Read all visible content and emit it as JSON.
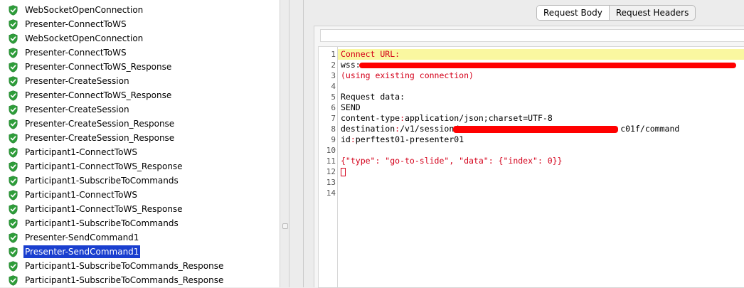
{
  "tree": {
    "items": [
      {
        "label": "WebSocketOpenConnection",
        "selected": false
      },
      {
        "label": "Presenter-ConnectToWS",
        "selected": false
      },
      {
        "label": "WebSocketOpenConnection",
        "selected": false
      },
      {
        "label": "Presenter-ConnectToWS",
        "selected": false
      },
      {
        "label": "Presenter-ConnectToWS_Response",
        "selected": false
      },
      {
        "label": "Presenter-CreateSession",
        "selected": false
      },
      {
        "label": "Presenter-ConnectToWS_Response",
        "selected": false
      },
      {
        "label": "Presenter-CreateSession",
        "selected": false
      },
      {
        "label": "Presenter-CreateSession_Response",
        "selected": false
      },
      {
        "label": "Presenter-CreateSession_Response",
        "selected": false
      },
      {
        "label": "Participant1-ConnectToWS",
        "selected": false
      },
      {
        "label": "Participant1-ConnectToWS_Response",
        "selected": false
      },
      {
        "label": "Participant1-SubscribeToCommands",
        "selected": false
      },
      {
        "label": "Participant1-ConnectToWS",
        "selected": false
      },
      {
        "label": "Participant1-ConnectToWS_Response",
        "selected": false
      },
      {
        "label": "Participant1-SubscribeToCommands",
        "selected": false
      },
      {
        "label": "Presenter-SendCommand1",
        "selected": false
      },
      {
        "label": "Presenter-SendCommand1",
        "selected": true
      },
      {
        "label": "Participant1-SubscribeToCommands_Response",
        "selected": false
      },
      {
        "label": "Participant1-SubscribeToCommands_Response",
        "selected": false
      }
    ],
    "status_icon": "green-shield-check-icon",
    "status_color": "#2e9d3a",
    "selection_color": "#1a3fcf"
  },
  "tabs": [
    {
      "label": "Request Body",
      "active": true
    },
    {
      "label": "Request Headers",
      "active": false
    }
  ],
  "editor": {
    "line_numbers": [
      "1",
      "2",
      "3",
      "4",
      "5",
      "6",
      "7",
      "8",
      "9",
      "10",
      "11",
      "12",
      "13",
      "14"
    ],
    "lines": {
      "l1": "Connect URL:",
      "l2_prefix": "wss:",
      "l3": "(using existing connection)",
      "l5": "Request data:",
      "l6": "SEND",
      "l7_key": "content-type",
      "l7_val": "application/json;charset=UTF-8",
      "l8_key": "destination",
      "l8_val": "/v1/session/",
      "l8_suffix": "c01f/command",
      "l9_key": "id",
      "l9_val": "perftest01-presenter01",
      "l11": "{\"type\": \"go-to-slide\", \"data\": {\"index\": 0}}"
    },
    "highlight_color": "#faf7a0",
    "redaction_color": "#ff0000"
  }
}
